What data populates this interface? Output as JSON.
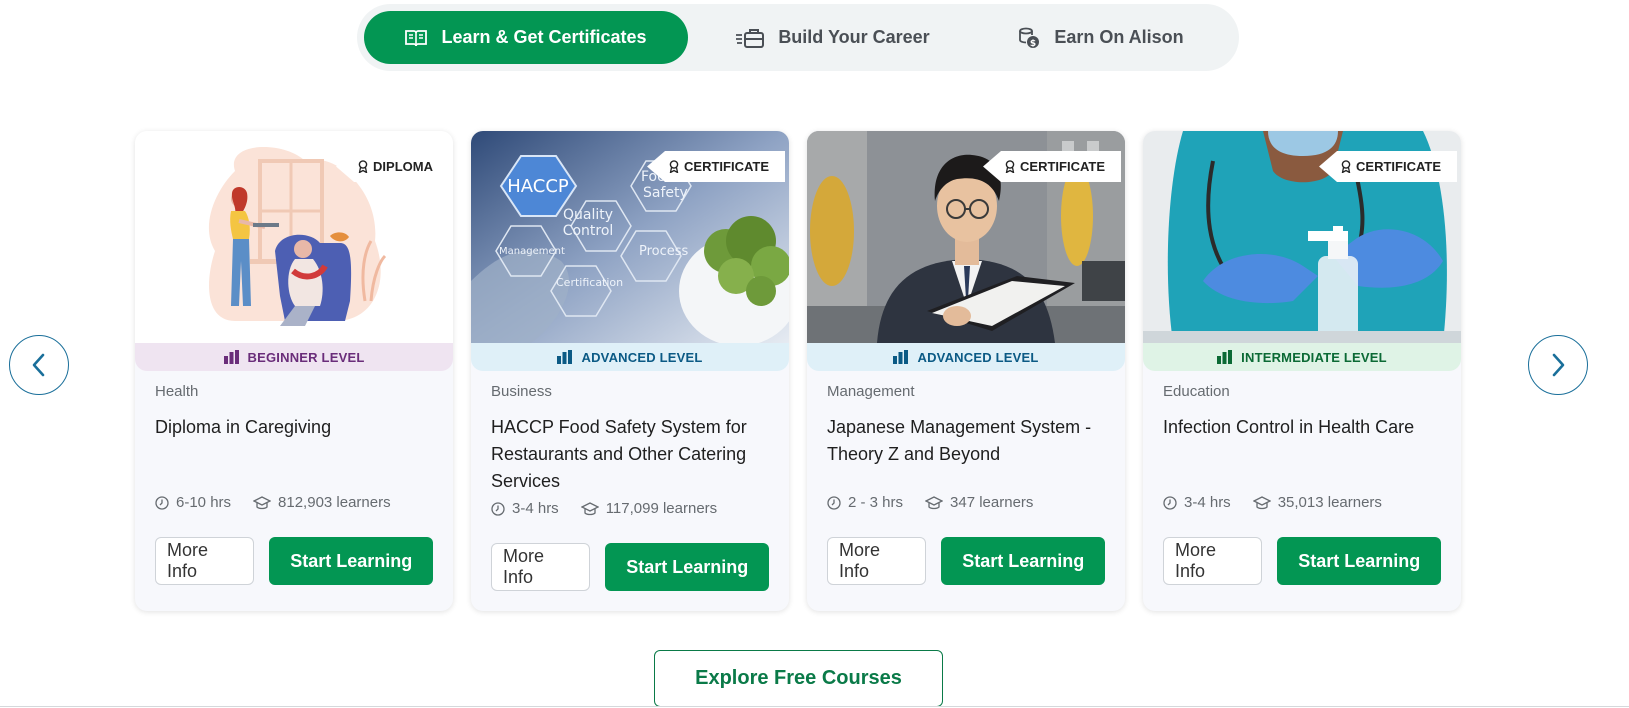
{
  "tabs": [
    {
      "label": "Learn & Get Certificates",
      "icon": "open-book-icon",
      "active": true
    },
    {
      "label": "Build Your Career",
      "icon": "briefcase-icon",
      "active": false
    },
    {
      "label": "Earn On Alison",
      "icon": "coins-icon",
      "active": false
    }
  ],
  "carousel": {
    "prev_icon": "chevron-left-icon",
    "next_icon": "chevron-right-icon"
  },
  "cards": [
    {
      "badge": "DIPLOMA",
      "level": "BEGINNER LEVEL",
      "category": "Health",
      "title": "Diploma in Caregiving",
      "duration": "6-10 hrs",
      "learners": "812,903 learners",
      "more_info": "More Info",
      "start": "Start Learning"
    },
    {
      "badge": "CERTIFICATE",
      "level": "ADVANCED LEVEL",
      "category": "Business",
      "title": "HACCP Food Safety System for Restaurants and Other Catering Services",
      "duration": "3-4 hrs",
      "learners": "117,099 learners",
      "more_info": "More Info",
      "start": "Start Learning",
      "image_text": [
        "HACCP",
        "Quality",
        "Control",
        "Food",
        "Safety",
        "Process",
        "Certification",
        "Management"
      ]
    },
    {
      "badge": "CERTIFICATE",
      "level": "ADVANCED LEVEL",
      "category": "Management",
      "title": "Japanese Management System - Theory Z and Beyond",
      "duration": "2 - 3 hrs",
      "learners": "347 learners",
      "more_info": "More Info",
      "start": "Start Learning"
    },
    {
      "badge": "CERTIFICATE",
      "level": "INTERMEDIATE LEVEL",
      "category": "Education",
      "title": "Infection Control in Health Care",
      "duration": "3-4 hrs",
      "learners": "35,013 learners",
      "more_info": "More Info",
      "start": "Start Learning"
    }
  ],
  "explore_label": "Explore Free Courses",
  "colors": {
    "brand_green": "#039653",
    "arrow_blue": "#1a6f9a",
    "beginner": "#6a2d7a",
    "advanced": "#0b5a85",
    "intermediate": "#0b6a35"
  }
}
